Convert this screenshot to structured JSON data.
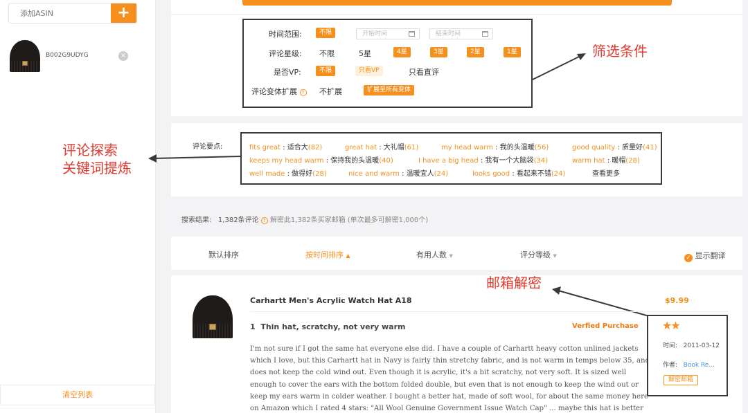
{
  "sidebar": {
    "asin_placeholder": "添加ASIN",
    "add_symbol": "+",
    "item": {
      "asin": "B002G9UDYG"
    },
    "clear_label": "清空列表"
  },
  "filters": {
    "time_label": "时间范围:",
    "time_any": "不限",
    "start_placeholder": "开始时间",
    "end_placeholder": "结束时间",
    "rating_label": "评论星级:",
    "rating_options": [
      "不限",
      "5星",
      "4星",
      "3星",
      "2星",
      "1星"
    ],
    "vp_label": "是否VP:",
    "vp_options": [
      "不限",
      "只看VP",
      "只看直评"
    ],
    "variant_label": "评论变体扩展",
    "variant_options": [
      "不扩展",
      "扩展至所有变体"
    ]
  },
  "keywords": {
    "label": "评论要点:",
    "items": [
      {
        "en": "fits great",
        "zh": "适合大",
        "count": "(82)"
      },
      {
        "en": "great hat",
        "zh": "大礼帽",
        "count": "(61)"
      },
      {
        "en": "my head warm",
        "zh": "我的头温暖",
        "count": "(56)"
      },
      {
        "en": "good quality",
        "zh": "质量好",
        "count": "(41)"
      },
      {
        "en": "keeps my head warm",
        "zh": "保持我的头温暖",
        "count": "(40)"
      },
      {
        "en": "I have a big head",
        "zh": "我有一个大脑袋",
        "count": "(34)"
      },
      {
        "en": "warm hat",
        "zh": "暖帽",
        "count": "(28)"
      },
      {
        "en": "well made",
        "zh": "做得好",
        "count": "(28)"
      },
      {
        "en": "nice and warm",
        "zh": "温暖宜人",
        "count": "(24)"
      },
      {
        "en": "looks good",
        "zh": "看起来不错",
        "count": "(24)"
      }
    ],
    "more": "查看更多"
  },
  "results": {
    "label": "搜索结果:",
    "count": "1,382条评论",
    "decrypt_text": "解密此1,382条买家邮箱 (单次最多可解密1,000个)"
  },
  "sort": {
    "default": "默认排序",
    "by_time": "按时间排序",
    "helpful": "有用人数",
    "rating": "评分等级",
    "translate": "显示翻译"
  },
  "review": {
    "product_title": "Carhartt Men's Acrylic Watch Hat A18",
    "price": "$9.99",
    "index": "1",
    "headline": "Thin hat, scratchy, not very warm",
    "verified": "Verfied Purchase",
    "body_lines": [
      "I'm not sure if I got the same hat everyone else did. I have a couple of Carhartt heavy cotton unlined jackets",
      "which I love, but this Carhartt hat in Navy is fairly thin stretchy fabric, and is not warm in temps below 35, and",
      "does not keep the cold wind out. Even though it is acrylic, it's a bit scratchy, not very soft. It is sized well",
      "enough to cover the ears with the bottom folded double, but even that is not enough to keep the wind out or",
      "keep my ears warm in colder weather. I bought a better hat, made of soft wool, for about the same money here",
      "on Amazon which I rated 4 stars: \"All Wool Genuine Government Issue Watch Cap\" ... maybe this hat is better"
    ],
    "stars": 2,
    "time_label": "时间:",
    "time_value": "2011-03-12",
    "author_label": "作者:",
    "author_value": "Book Re...",
    "decrypt_button": "解密邮箱"
  },
  "annotations": {
    "filter": "筛选条件",
    "keywords_line1": "评论探索",
    "keywords_line2": "关键词提炼",
    "email": "邮箱解密"
  },
  "colors": {
    "accent": "#f5901e",
    "annotation": "#e23a2e"
  }
}
